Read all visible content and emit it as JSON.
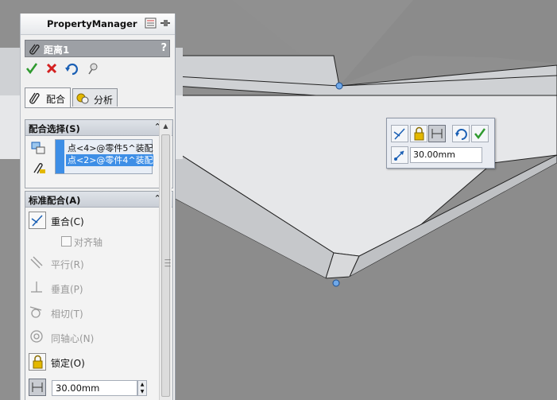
{
  "panel": {
    "title": "PropertyManager",
    "feature_name": "距离1",
    "help": "?",
    "actions": [
      "ok-icon",
      "cancel-icon",
      "undo-icon",
      "pin-icon"
    ]
  },
  "tabs": [
    {
      "label": "配合",
      "icon": "paperclip-icon",
      "selected": true
    },
    {
      "label": "分析",
      "icon": "analysis-icon",
      "selected": false
    }
  ],
  "mate_selections": {
    "title": "配合选择(S)",
    "items": [
      "点<4>@零件5^装配",
      "点<2>@零件4^装配"
    ]
  },
  "standard_mates": {
    "title": "标准配合(A)",
    "coincident": "重合(C)",
    "align_axis": "对齐轴",
    "parallel": "平行(R)",
    "perpendicular": "垂直(P)",
    "tangent": "相切(T)",
    "concentric": "同轴心(N)",
    "lock": "锁定(O)",
    "distance_value": "30.00mm"
  },
  "mini_toolbar": {
    "distance_value": "30.00mm"
  },
  "colors": {
    "accent_highlight": "#3d8ee6",
    "point_marker": "#6fa8e8",
    "ok_green": "#2f9a2f",
    "cancel_red": "#d42020"
  }
}
